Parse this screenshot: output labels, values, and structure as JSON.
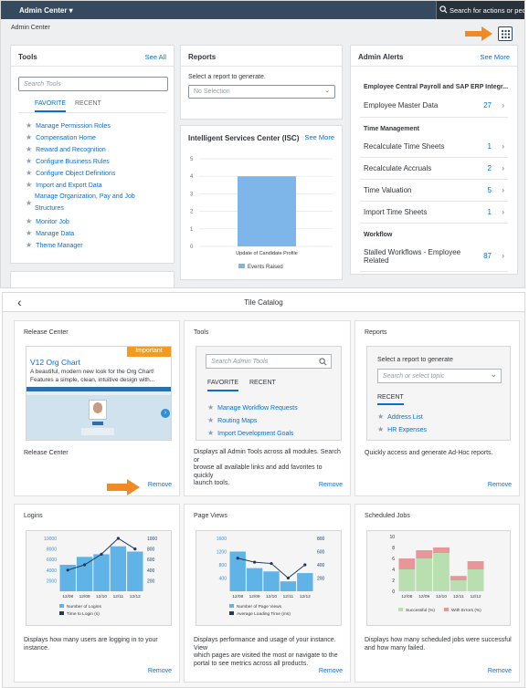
{
  "shell": {
    "title": "Admin Center ▾",
    "search_placeholder": "Search for actions or peo..."
  },
  "breadcrumb": "Admin Center",
  "tools": {
    "title": "Tools",
    "see_all": "See All",
    "search_placeholder": "Search Tools",
    "tab_favorite": "FAVORITE",
    "tab_recent": "RECENT",
    "items": [
      "Manage Permission Roles",
      "Compensation Home",
      "Reward and Recognition",
      "Configure Business Rules",
      "Configure Object Definitions",
      "Import and Export Data",
      "Manage Organization, Pay and Job",
      "Structures",
      "Monitor Job",
      "Manage Data",
      "Theme Manager"
    ]
  },
  "reports": {
    "title": "Reports",
    "prompt": "Select a report to generate.",
    "select_value": "No Selection"
  },
  "isc": {
    "title": "Intelligent Services Center (ISC)",
    "see_more": "See More",
    "chart_data": {
      "type": "bar",
      "categories": [
        "Update of Candidate Profile"
      ],
      "series": [
        {
          "name": "Events Raised",
          "values": [
            4
          ]
        }
      ],
      "ylim": [
        0,
        5
      ],
      "yticks": [
        "0",
        "1",
        "2",
        "3",
        "4",
        "5"
      ],
      "color": "#7fb6ea"
    }
  },
  "alerts": {
    "title": "Admin Alerts",
    "see_more": "See More",
    "sec1": "Employee Central Payroll and SAP ERP Integr...",
    "r1_label": "Employee Master Data",
    "r1_count": "27",
    "sec2": "Time Management",
    "r2_label": "Recalculate Time Sheets",
    "r2_count": "1",
    "r3_label": "Recalculate Accruals",
    "r3_count": "2",
    "r4_label": "Time Valuation",
    "r4_count": "5",
    "r5_label": "Import Time Sheets",
    "r5_count": "1",
    "sec3": "Workflow",
    "r6_label": "Stalled Workflows - Employee",
    "r6_label2": "Related",
    "r6_count": "87",
    "chev": "›"
  },
  "catalog": {
    "back": "‹",
    "title": "Tile Catalog"
  },
  "release": {
    "title": "Release Center",
    "badge": "Important",
    "headline": "V12 Org Chart",
    "body1": "A beautiful, modern new look for the Org Chart!",
    "body2": "Features a simple, clean, intuitive design with...",
    "desc": "Release Center",
    "remove": "Remove"
  },
  "tools2": {
    "title": "Tools",
    "search_placeholder": "Search Admin Tools",
    "tab_favorite": "FAVORITE",
    "tab_recent": "RECENT",
    "items": [
      "Manage Workflow Requests",
      "Routing Maps",
      "Import Development Goals"
    ],
    "desc1": "Displays all Admin Tools across all modules. Search or",
    "desc2": "browse all available links and add favorites to quickly",
    "desc3": "launch tools.",
    "remove": "Remove"
  },
  "reports2": {
    "title": "Reports",
    "prompt": "Select a report to generate",
    "select_placeholder": "Search or select topic",
    "recent": "RECENT",
    "items": [
      "Address List",
      "HR Expenses"
    ],
    "desc": "Quickly access and generate Ad-Hoc reports.",
    "remove": "Remove"
  },
  "logins": {
    "title": "Logins",
    "chart_data": {
      "type": "bar",
      "categories": [
        "12/08",
        "12/09",
        "12/10",
        "12/11",
        "12/12"
      ],
      "series": [
        {
          "name": "Number of Logins",
          "values": [
            5000,
            6500,
            7000,
            8500,
            7500
          ],
          "type": "bar"
        },
        {
          "name": "Time to Login (s)",
          "values": [
            400,
            500,
            700,
            1000,
            800
          ],
          "type": "line"
        }
      ],
      "yleft_ticks": [
        "10000",
        "8000",
        "6000",
        "4000",
        "2000"
      ],
      "yright_ticks": [
        "1000",
        "800",
        "600",
        "400",
        "200"
      ],
      "ylim_left": [
        0,
        10000
      ],
      "ylim_right": [
        0,
        1000
      ],
      "bar_color": "#5fb3e6",
      "line_color": "#1f3a5a"
    },
    "desc1": "Displays how many users are logging in to your",
    "desc2": "instance.",
    "remove": "Remove"
  },
  "pageviews": {
    "title": "Page Views",
    "chart_data": {
      "type": "bar",
      "categories": [
        "12/08",
        "12/09",
        "12/10",
        "12/11",
        "12/12"
      ],
      "series": [
        {
          "name": "Number of Page Views",
          "values": [
            1200,
            700,
            600,
            300,
            550
          ],
          "type": "bar"
        },
        {
          "name": "Average Loading Time (ms)",
          "values": [
            500,
            440,
            420,
            200,
            400
          ],
          "type": "line"
        }
      ],
      "yleft_ticks": [
        "1600",
        "1200",
        "800",
        "400"
      ],
      "yright_ticks": [
        "800",
        "600",
        "400",
        "200"
      ],
      "ylim_left": [
        0,
        1600
      ],
      "ylim_right": [
        0,
        800
      ],
      "bar_color": "#5fb3e6",
      "line_color": "#1f3a5a"
    },
    "desc1": "Displays performance and usage of your instance. View",
    "desc2": "which pages are visited the most or navigate to the",
    "desc3": "portal to see metrics across all products.",
    "remove": "Remove"
  },
  "jobs": {
    "title": "Scheduled Jobs",
    "chart_data": {
      "type": "bar",
      "categories": [
        "12/08",
        "12/09",
        "12/10",
        "12/11",
        "12/12"
      ],
      "series": [
        {
          "name": "Successful (%)",
          "values": [
            4,
            6,
            7,
            2,
            4
          ]
        },
        {
          "name": "With Errors (%)",
          "values": [
            2,
            1.5,
            1,
            0.8,
            1.5
          ]
        }
      ],
      "yticks": [
        "10",
        "8",
        "6",
        "4",
        "2",
        "0"
      ],
      "ylim": [
        0,
        10
      ],
      "colors": [
        "#b9dfb0",
        "#e8969a"
      ]
    },
    "desc1": "Displays how many scheduled jobs were successful",
    "desc2": "and how many failed.",
    "remove": "Remove"
  }
}
